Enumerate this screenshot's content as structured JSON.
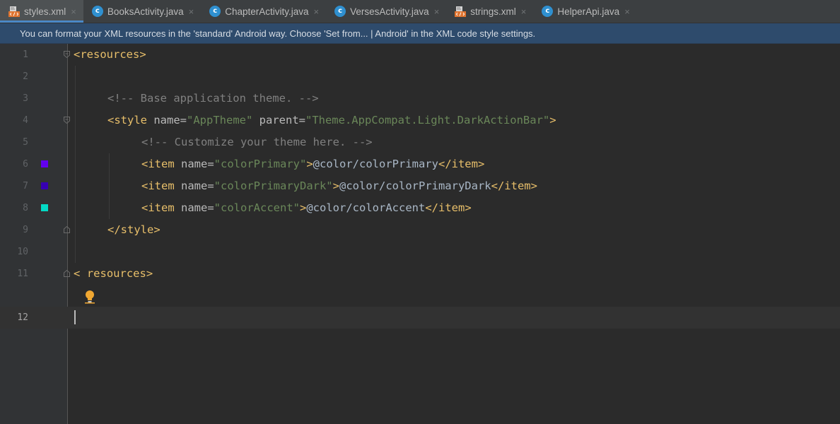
{
  "tabs": [
    {
      "label": "styles.xml",
      "icon": "xml-file-icon",
      "active": true
    },
    {
      "label": "BooksActivity.java",
      "icon": "java-class-icon",
      "active": false
    },
    {
      "label": "ChapterActivity.java",
      "icon": "java-class-icon",
      "active": false
    },
    {
      "label": "VersesActivity.java",
      "icon": "java-class-icon",
      "active": false
    },
    {
      "label": "strings.xml",
      "icon": "xml-file-icon",
      "active": false
    },
    {
      "label": "HelperApi.java",
      "icon": "java-class-icon",
      "active": false
    }
  ],
  "tab_close_glyph": "×",
  "java_icon_letter": "c",
  "banner": {
    "text": "You can format your XML resources in the 'standard' Android way. Choose 'Set from... | Android' in the XML code style settings."
  },
  "editor": {
    "current_line": 12,
    "lines": [
      {
        "num": "1"
      },
      {
        "num": "2"
      },
      {
        "num": "3"
      },
      {
        "num": "4"
      },
      {
        "num": "5"
      },
      {
        "num": "6"
      },
      {
        "num": "7"
      },
      {
        "num": "8"
      },
      {
        "num": "9"
      },
      {
        "num": "10"
      },
      {
        "num": "11"
      },
      {
        "num": "12"
      }
    ],
    "code": {
      "l1_open": "<resources>",
      "l3_comment": "<!-- Base application theme. -->",
      "l4_tag_open": "<style ",
      "l4_attr1": "name=",
      "l4_val1": "\"AppTheme\"",
      "l4_attr2": " parent=",
      "l4_val2": "\"Theme.AppCompat.Light.DarkActionBar\"",
      "l4_close": ">",
      "l5_comment": "<!-- Customize your theme here. -->",
      "l6_tag": "<item ",
      "l6_attr": "name=",
      "l6_val": "\"colorPrimary\"",
      "l6_gt": ">",
      "l6_text": "@color/colorPrimary",
      "l6_end": "</item>",
      "l7_tag": "<item ",
      "l7_attr": "name=",
      "l7_val": "\"colorPrimaryDark\"",
      "l7_gt": ">",
      "l7_text": "@color/colorPrimaryDark",
      "l7_end": "</item>",
      "l8_tag": "<item ",
      "l8_attr": "name=",
      "l8_val": "\"colorAccent\"",
      "l8_gt": ">",
      "l8_text": "@color/colorAccent",
      "l8_end": "</item>",
      "l9_close": "</style>",
      "l11_lt": "<",
      "l11_rest": "resources>"
    },
    "swatches": {
      "colorPrimary": "#6200EE",
      "colorPrimaryDark": "#3700B3",
      "colorAccent": "#03DAC5"
    }
  }
}
